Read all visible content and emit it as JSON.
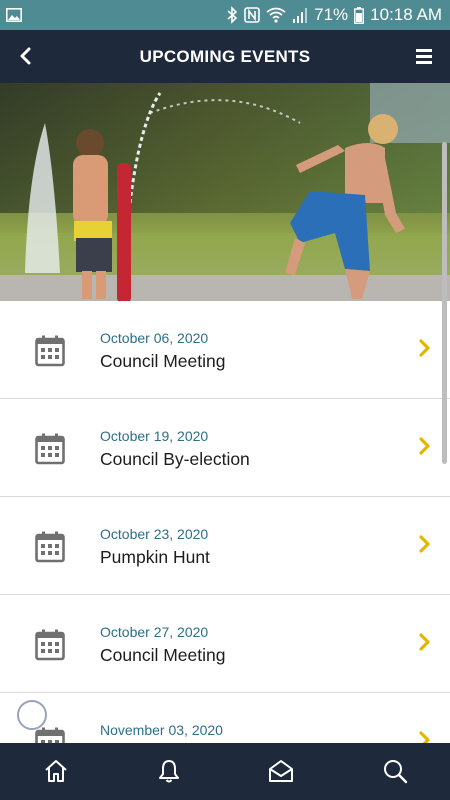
{
  "statusbar": {
    "battery": "71%",
    "time": "10:18 AM"
  },
  "header": {
    "title": "UPCOMING EVENTS"
  },
  "events": [
    {
      "date": "October 06, 2020",
      "name": "Council Meeting"
    },
    {
      "date": "October 19, 2020",
      "name": "Council By-election"
    },
    {
      "date": "October 23, 2020",
      "name": "Pumpkin Hunt"
    },
    {
      "date": "October 27, 2020",
      "name": "Council Meeting"
    },
    {
      "date": "November 03, 2020",
      "name": ""
    }
  ],
  "colors": {
    "statusbar": "#4e8b92",
    "header": "#1e2a3c",
    "date_text": "#2d6f86",
    "chevron": "#e3b600"
  },
  "icons": {
    "list": "calendar-icon",
    "chevron": "chevron-right-icon",
    "nav": [
      "home-icon",
      "bell-icon",
      "mail-open-icon",
      "search-icon"
    ]
  }
}
